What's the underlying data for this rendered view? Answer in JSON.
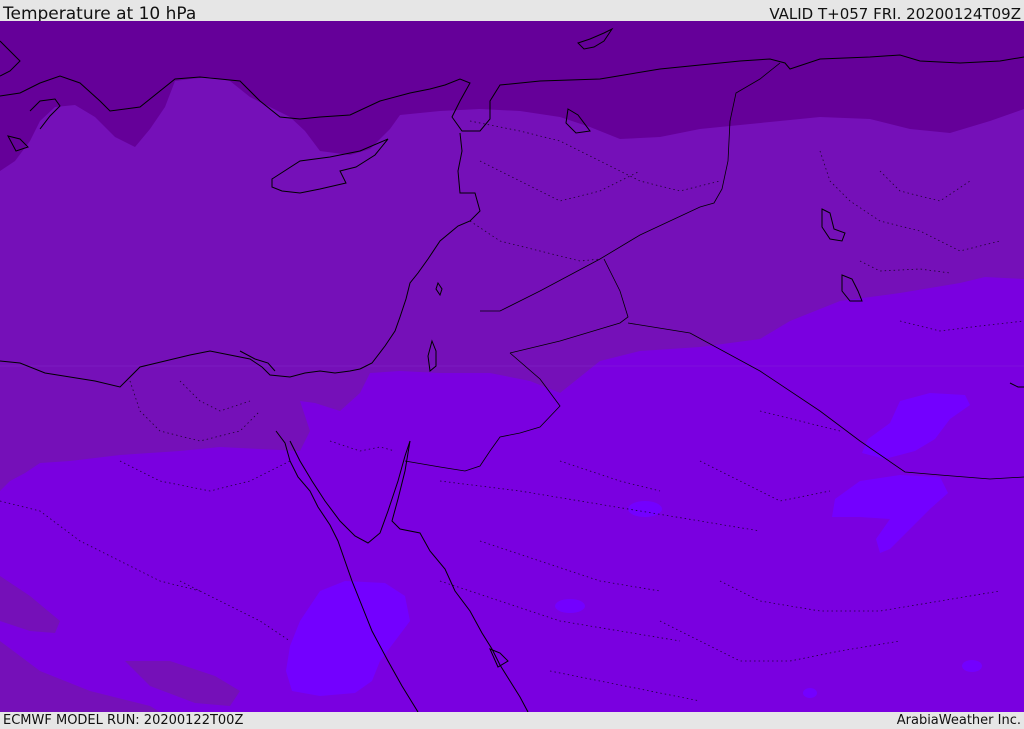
{
  "header": {
    "title": "Temperature at 10 hPa",
    "valid": "VALID T+057 FRI. 20200124T09Z"
  },
  "footer": {
    "model_run": "ECMWF MODEL RUN: 20200122T00Z",
    "credit": "ArabiaWeather Inc."
  },
  "colors": {
    "band_coldest": "#650099",
    "band_cold": "#7510b8",
    "band_mid": "#7a00e0",
    "band_warm": "#7300ff",
    "coastline": "#000000",
    "background": "#e6e6e6"
  }
}
